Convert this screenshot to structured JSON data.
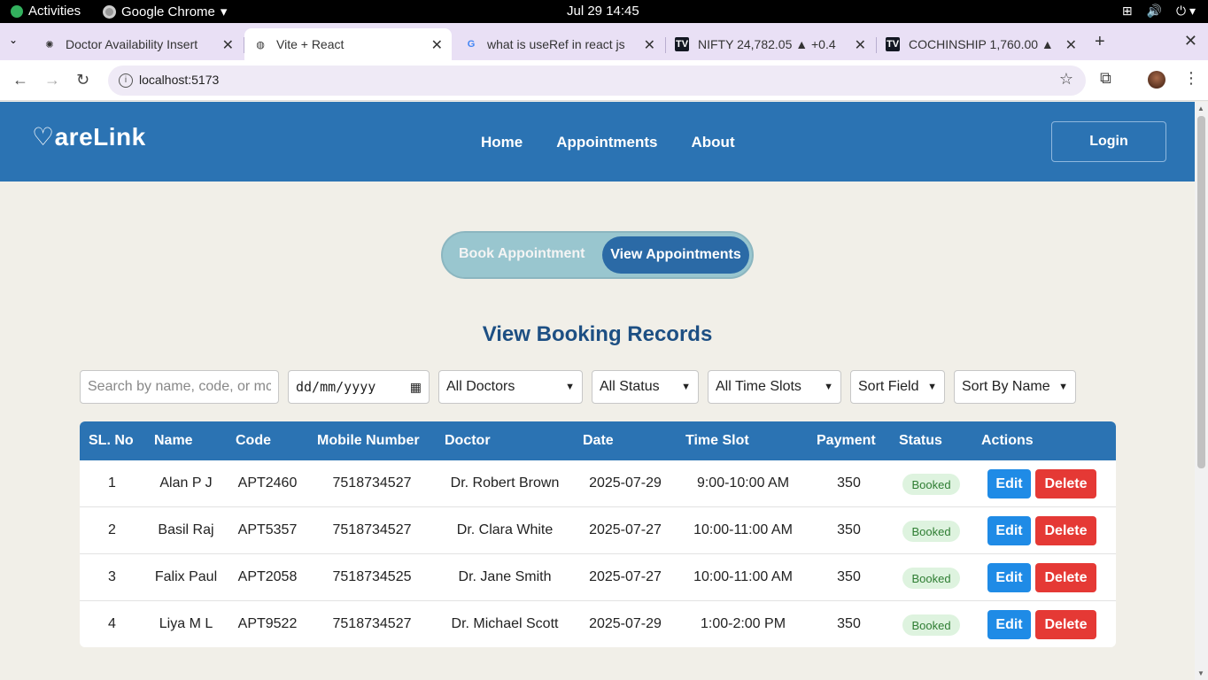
{
  "system": {
    "activities": "Activities",
    "app_name": "Google Chrome",
    "clock": "Jul 29  14:45"
  },
  "browser": {
    "tabs": [
      {
        "title": "Doctor Availability Insert",
        "favicon": "chatgpt-icon"
      },
      {
        "title": "Vite + React",
        "favicon": "globe-icon"
      },
      {
        "title": "what is useRef in react js",
        "favicon": "google-icon"
      },
      {
        "title": "NIFTY 24,782.05 ▲ +0.4",
        "favicon": "tradingview-icon"
      },
      {
        "title": "COCHINSHIP 1,760.00 ▲",
        "favicon": "tradingview-icon"
      }
    ],
    "url": "localhost:5173"
  },
  "header": {
    "logo": "areLink",
    "nav": [
      "Home",
      "Appointments",
      "About"
    ],
    "login": "Login",
    "color": "#2b73b3"
  },
  "toggle": {
    "book": "Book Appointment",
    "view": "View Appointments",
    "active": "view"
  },
  "page_title": "View Booking Records",
  "filters": {
    "search_placeholder": "Search by name, code, or mc",
    "date_placeholder": "dd/mm/yyyy",
    "doctor": "All Doctors",
    "status": "All Status",
    "time_slot": "All Time Slots",
    "sort_field": "Sort Field",
    "sort_by": "Sort By Name"
  },
  "table": {
    "headers": [
      "SL. No",
      "Name",
      "Code",
      "Mobile Number",
      "Doctor",
      "Date",
      "Time Slot",
      "Payment",
      "Status",
      "Actions"
    ],
    "rows": [
      {
        "sl": "1",
        "name": "Alan P J",
        "code": "APT2460",
        "mobile": "7518734527",
        "doctor": "Dr. Robert Brown",
        "date": "2025-07-29",
        "slot": "9:00-10:00 AM",
        "payment": "350",
        "status": "Booked"
      },
      {
        "sl": "2",
        "name": "Basil Raj",
        "code": "APT5357",
        "mobile": "7518734527",
        "doctor": "Dr. Clara White",
        "date": "2025-07-27",
        "slot": "10:00-11:00 AM",
        "payment": "350",
        "status": "Booked"
      },
      {
        "sl": "3",
        "name": "Falix Paul",
        "code": "APT2058",
        "mobile": "7518734525",
        "doctor": "Dr. Jane Smith",
        "date": "2025-07-27",
        "slot": "10:00-11:00 AM",
        "payment": "350",
        "status": "Booked"
      },
      {
        "sl": "4",
        "name": "Liya M L",
        "code": "APT9522",
        "mobile": "7518734527",
        "doctor": "Dr. Michael Scott",
        "date": "2025-07-29",
        "slot": "1:00-2:00 PM",
        "payment": "350",
        "status": "Booked"
      }
    ],
    "edit_label": "Edit",
    "delete_label": "Delete"
  }
}
